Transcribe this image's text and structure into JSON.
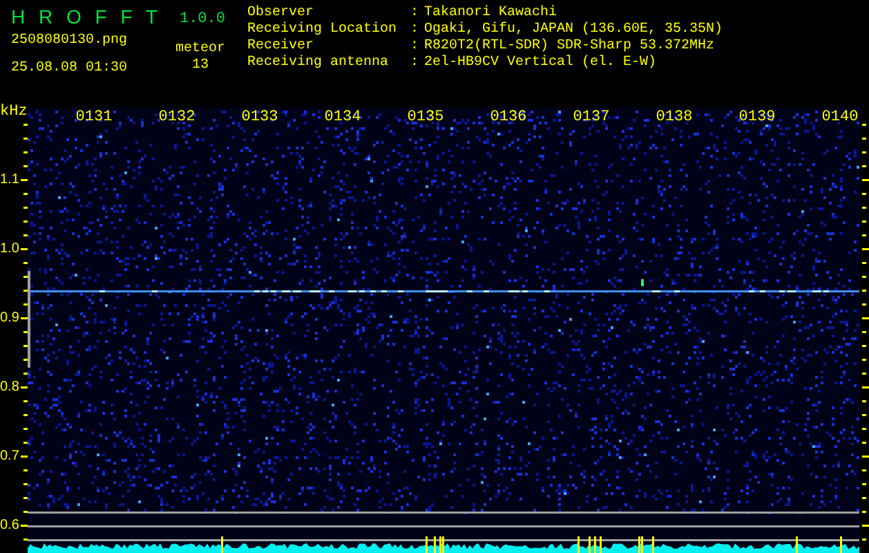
{
  "app": {
    "name": "H R O F F T",
    "version": "1.0.0"
  },
  "file": "2508080130.png",
  "datetime": "25.08.08 01:30",
  "meteor": {
    "label": "meteor",
    "count": "13"
  },
  "info": [
    {
      "label": "Observer",
      "separator": ":",
      "value": "Takanori Kawachi"
    },
    {
      "label": "Receiving Location",
      "separator": ":",
      "value": "Ogaki, Gifu, JAPAN (136.60E, 35.35N)"
    },
    {
      "label": "Receiver",
      "separator": ":",
      "value": "R820T2(RTL-SDR) SDR-Sharp 53.372MHz"
    },
    {
      "label": "Receiving antenna",
      "separator": ":",
      "value": "2el-HB9CV Vertical (el. E-W)"
    }
  ],
  "spectrogram": {
    "unit": "kHz",
    "time_labels": [
      "0131",
      "0132",
      "0133",
      "0134",
      "0135",
      "0136",
      "0137",
      "0138",
      "0139",
      "0140"
    ],
    "freq_labels": [
      "1.1",
      "1.0",
      "0.9",
      "0.8",
      "0.7",
      "0.6"
    ]
  }
}
